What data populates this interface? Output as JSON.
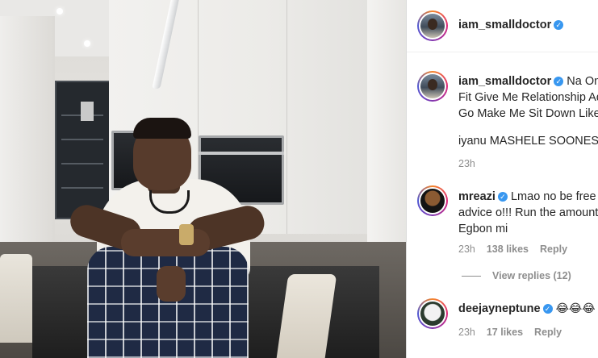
{
  "post": {
    "author": "iam_smalldoctor",
    "verified_badge": "✓"
  },
  "caption": {
    "username": "iam_smalldoctor",
    "lines": [
      "Na On",
      "Fit Give Me Relationship Ad",
      "Go Make Me Sit Down Like",
      "iyanu MASHELE SOONEST"
    ],
    "time": "23h"
  },
  "comments": [
    {
      "username": "mreazi",
      "lines": [
        "Lmao no be free",
        "advice o!!! Run the amount",
        "Egbon mi"
      ],
      "time": "23h",
      "likes": "138 likes",
      "reply_label": "Reply"
    },
    {
      "username": "deejayneptune",
      "emoji": "😂😂😂",
      "time": "23h",
      "likes": "17 likes",
      "reply_label": "Reply"
    }
  ],
  "view_replies": "View replies (12)",
  "icons": {
    "verified": "verified-badge-icon",
    "avatar_ring": "story-ring"
  },
  "colors": {
    "verified_blue": "#3897f0",
    "meta_gray": "#8e8e8e",
    "text": "#262626"
  }
}
